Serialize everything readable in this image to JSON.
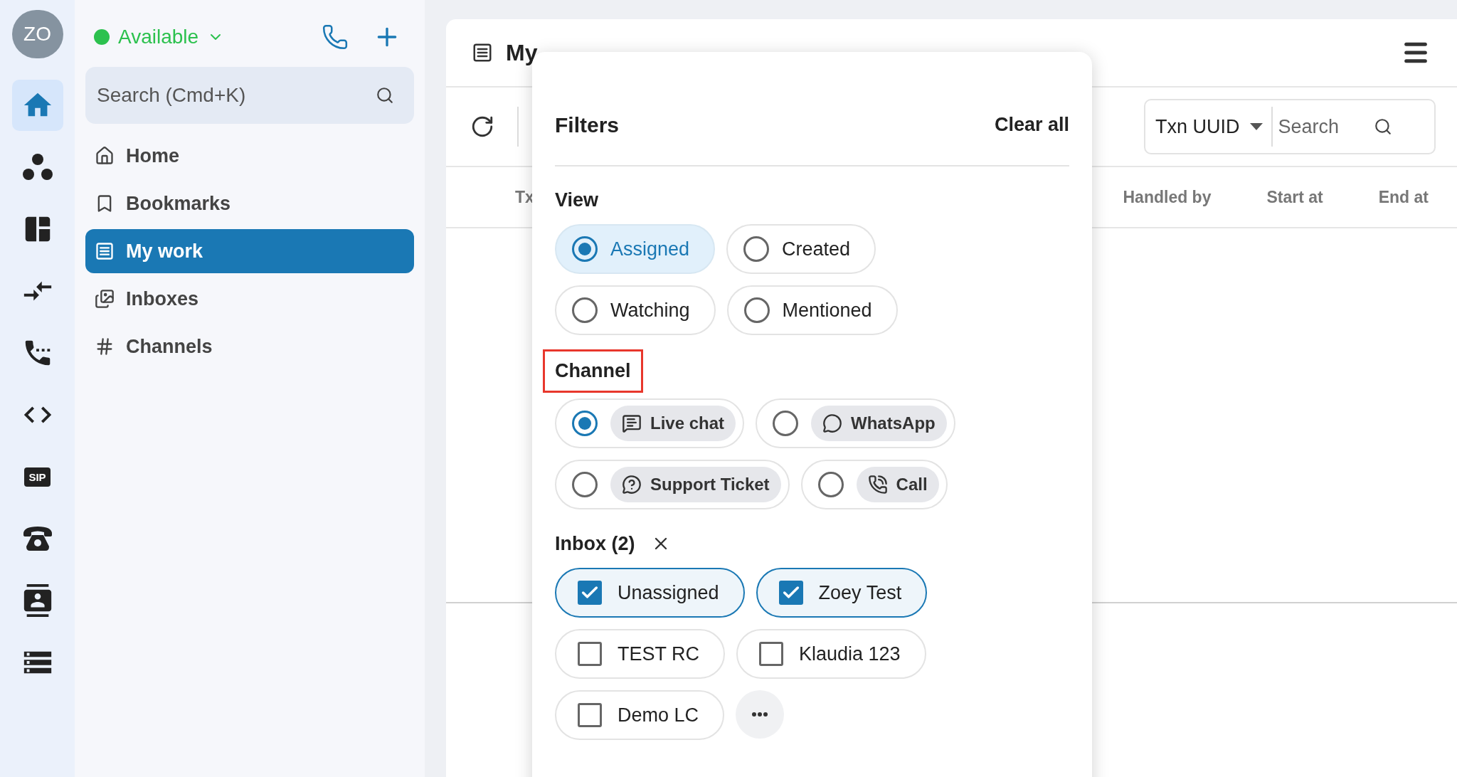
{
  "rail": {
    "avatar": "ZO",
    "items": [
      {
        "selected": true
      },
      {
        "selected": false
      },
      {
        "selected": false
      },
      {
        "selected": false
      },
      {
        "selected": false
      },
      {
        "selected": false
      },
      {
        "label": "SIP",
        "selected": false
      },
      {
        "selected": false
      },
      {
        "selected": false
      },
      {
        "selected": false
      }
    ]
  },
  "sidebar": {
    "status": "Available",
    "search": {
      "placeholder": "Search (Cmd+K)"
    },
    "items": [
      {
        "label": "Home",
        "selected": false
      },
      {
        "label": "Bookmarks",
        "selected": false
      },
      {
        "label": "My work",
        "selected": true
      },
      {
        "label": "Inboxes",
        "selected": false
      },
      {
        "label": "Channels",
        "selected": false
      }
    ]
  },
  "main": {
    "title": "My",
    "search_field": {
      "type": "Txn UUID",
      "placeholder": "Search"
    },
    "columns": [
      "Tx",
      "Handled by",
      "Start at",
      "End at"
    ]
  },
  "filters": {
    "title": "Filters",
    "clear": "Clear all",
    "sections": [
      {
        "kind": "radio",
        "title": "View",
        "highlighted": false,
        "options": [
          {
            "label": "Assigned",
            "selected": true
          },
          {
            "label": "Created",
            "selected": false
          },
          {
            "label": "Watching",
            "selected": false
          },
          {
            "label": "Mentioned",
            "selected": false
          }
        ]
      },
      {
        "kind": "channel",
        "title": "Channel",
        "highlighted": true,
        "options": [
          {
            "label": "Live chat",
            "selected": true
          },
          {
            "label": "WhatsApp",
            "selected": false
          },
          {
            "label": "Support Ticket",
            "selected": false
          },
          {
            "label": "Call",
            "selected": false
          }
        ]
      },
      {
        "kind": "checkbox",
        "title": "Inbox (2)",
        "highlighted": false,
        "options": [
          {
            "label": "Unassigned",
            "checked": true
          },
          {
            "label": "Zoey Test",
            "checked": true
          },
          {
            "label": "TEST RC",
            "checked": false
          },
          {
            "label": "Klaudia 123",
            "checked": false
          },
          {
            "label": "Demo LC",
            "checked": false
          }
        ]
      }
    ]
  }
}
